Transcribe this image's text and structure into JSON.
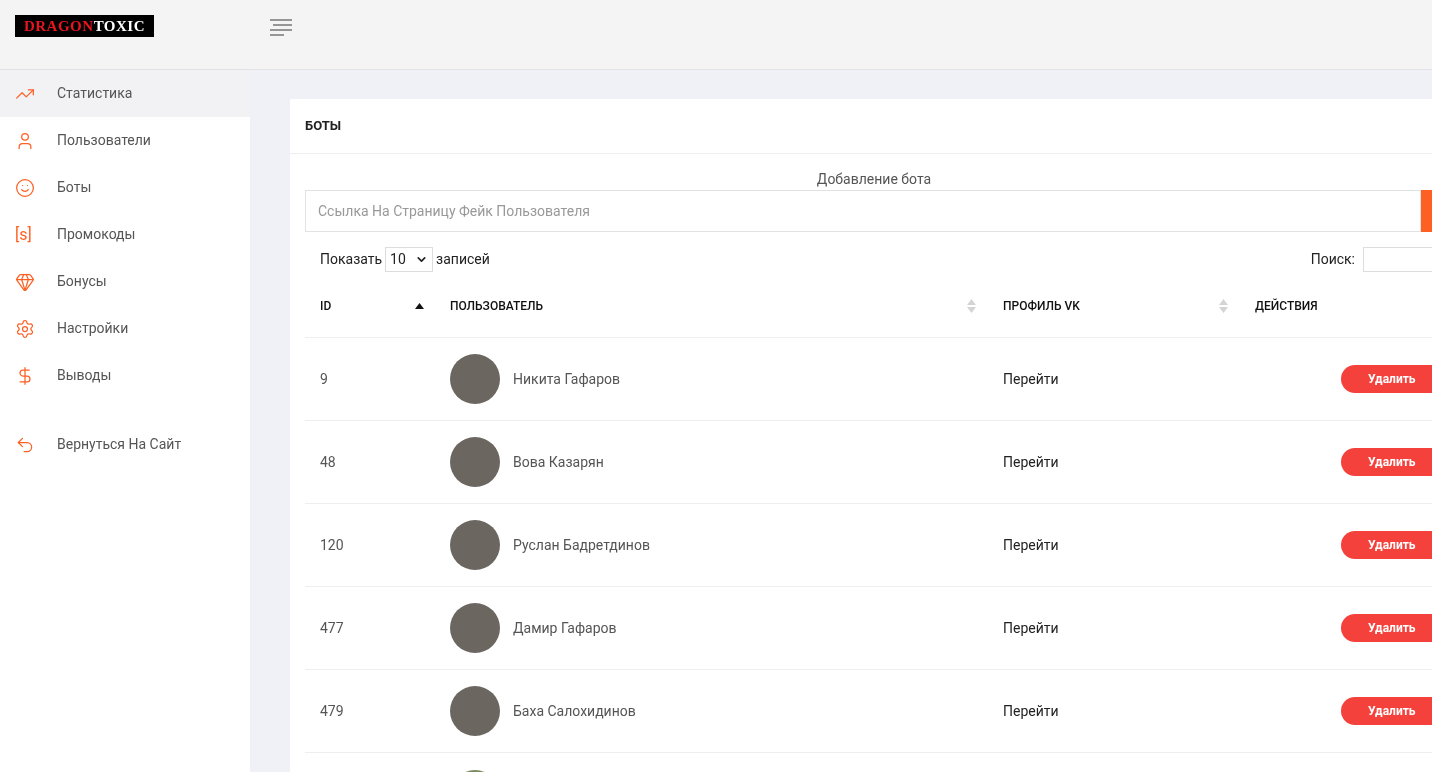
{
  "logo": {
    "part_1": "DRAGON",
    "part_2": "TOXIC"
  },
  "sidebar": {
    "items": [
      {
        "label": "Статистика",
        "kind": "chart",
        "selected": true
      },
      {
        "label": "Пользователи",
        "kind": "user",
        "selected": false
      },
      {
        "label": "Боты",
        "kind": "smile",
        "selected": false
      },
      {
        "label": "Промокоды",
        "kind": "glyph",
        "icon_text": "[s]",
        "selected": false
      },
      {
        "label": "Бонусы",
        "kind": "diamond",
        "selected": false
      },
      {
        "label": "Настройки",
        "kind": "gear",
        "selected": false
      },
      {
        "label": "Выводы",
        "kind": "dollar",
        "selected": false
      }
    ],
    "return_link": {
      "label": "Вернуться На Сайт"
    }
  },
  "card": {
    "title": "БОТЫ",
    "add_bot": {
      "label": "Добавление бота",
      "placeholder": "Ссылка На Страницу Фейк Пользователя"
    },
    "length_menu": {
      "prefix": "Показать",
      "value": "10",
      "suffix": "записей"
    },
    "search": {
      "label": "Поиск:"
    },
    "table": {
      "columns": [
        {
          "label": "ID",
          "kind": "sorted"
        },
        {
          "label": "ПОЛЬЗОВАТЕЛЬ",
          "kind": "sortable"
        },
        {
          "label": "ПРОФИЛЬ VK",
          "kind": "sortable"
        },
        {
          "label": "ДЕЙСТВИЯ",
          "kind": "plain"
        }
      ],
      "rows": [
        {
          "id": "9",
          "name": "Никита Гафаров",
          "profile_link": "Перейти",
          "action": "Удалить"
        },
        {
          "id": "48",
          "name": "Вова Казарян",
          "profile_link": "Перейти",
          "action": "Удалить"
        },
        {
          "id": "120",
          "name": "Руслан Бадретдинов",
          "profile_link": "Перейти",
          "action": "Удалить"
        },
        {
          "id": "477",
          "name": "Дамир Гафаров",
          "profile_link": "Перейти",
          "action": "Удалить"
        },
        {
          "id": "479",
          "name": "Баха Салохидинов",
          "profile_link": "Перейти",
          "action": "Удалить"
        }
      ],
      "next_row_peeks": true
    }
  }
}
